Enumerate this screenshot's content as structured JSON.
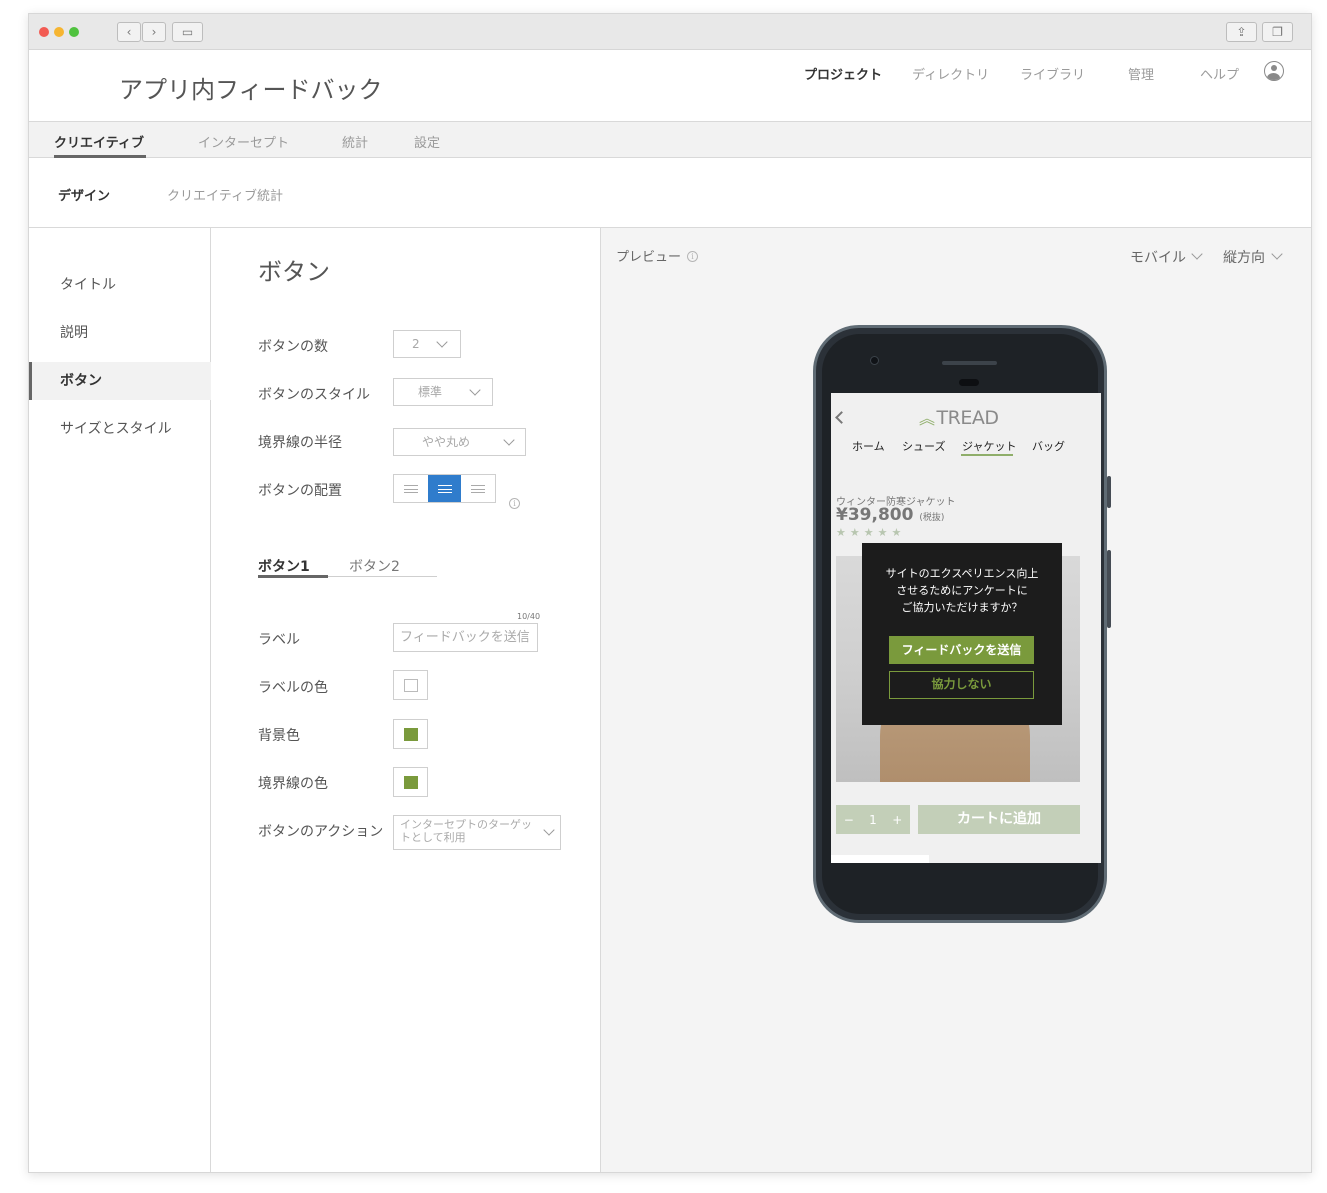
{
  "header": {
    "app_title": "アプリ内フィードバック",
    "nav": [
      "プロジェクト",
      "ディレクトリ",
      "ライブラリ",
      "管理",
      "ヘルプ"
    ]
  },
  "tabs": [
    "クリエイティブ",
    "インターセプト",
    "統計",
    "設定"
  ],
  "subtabs": [
    "デザイン",
    "クリエイティブ統計"
  ],
  "sidebar": {
    "items": [
      "タイトル",
      "説明",
      "ボタン",
      "サイズとスタイル"
    ]
  },
  "form": {
    "title": "ボタン",
    "button_count_label": "ボタンの数",
    "button_count_value": "2",
    "button_style_label": "ボタンのスタイル",
    "button_style_value": "標準",
    "border_radius_label": "境界線の半径",
    "border_radius_value": "やや丸め",
    "alignment_label": "ボタンの配置",
    "alignment_selected": "center",
    "button_tabs": [
      "ボタン1",
      "ボタン2"
    ],
    "label_label": "ラベル",
    "label_value": "フィードバックを送信",
    "label_counter": "10/40",
    "label_color_label": "ラベルの色",
    "label_color": "#ffffff",
    "bg_color_label": "背景色",
    "bg_color": "#7a9a3c",
    "border_color_label": "境界線の色",
    "border_color": "#7a9a3c",
    "action_label": "ボタンのアクション",
    "action_value": "インターセプトのターゲットとして利用"
  },
  "preview": {
    "title": "プレビュー",
    "device": "モバイル",
    "orientation": "縦方向",
    "screen": {
      "logo": "TREAD",
      "nav": [
        "ホーム",
        "シューズ",
        "ジャケット",
        "バッグ"
      ],
      "product_name": "ウィンター防寒ジャケット",
      "price": "¥39,800",
      "tax": "(税抜)",
      "stars": "★★★★★",
      "qty_minus": "−",
      "qty_value": "1",
      "qty_plus": "+",
      "cart_button": "カートに追加",
      "modal": {
        "line1": "サイトのエクスペリエンス向上",
        "line2": "させるためにアンケートに",
        "line3": "ご協力いただけますか？",
        "primary": "フィードバックを送信",
        "secondary": "協力しない"
      }
    }
  },
  "colors": {
    "accent_green": "#7a9a3c",
    "active_blue": "#2f7ccc"
  }
}
